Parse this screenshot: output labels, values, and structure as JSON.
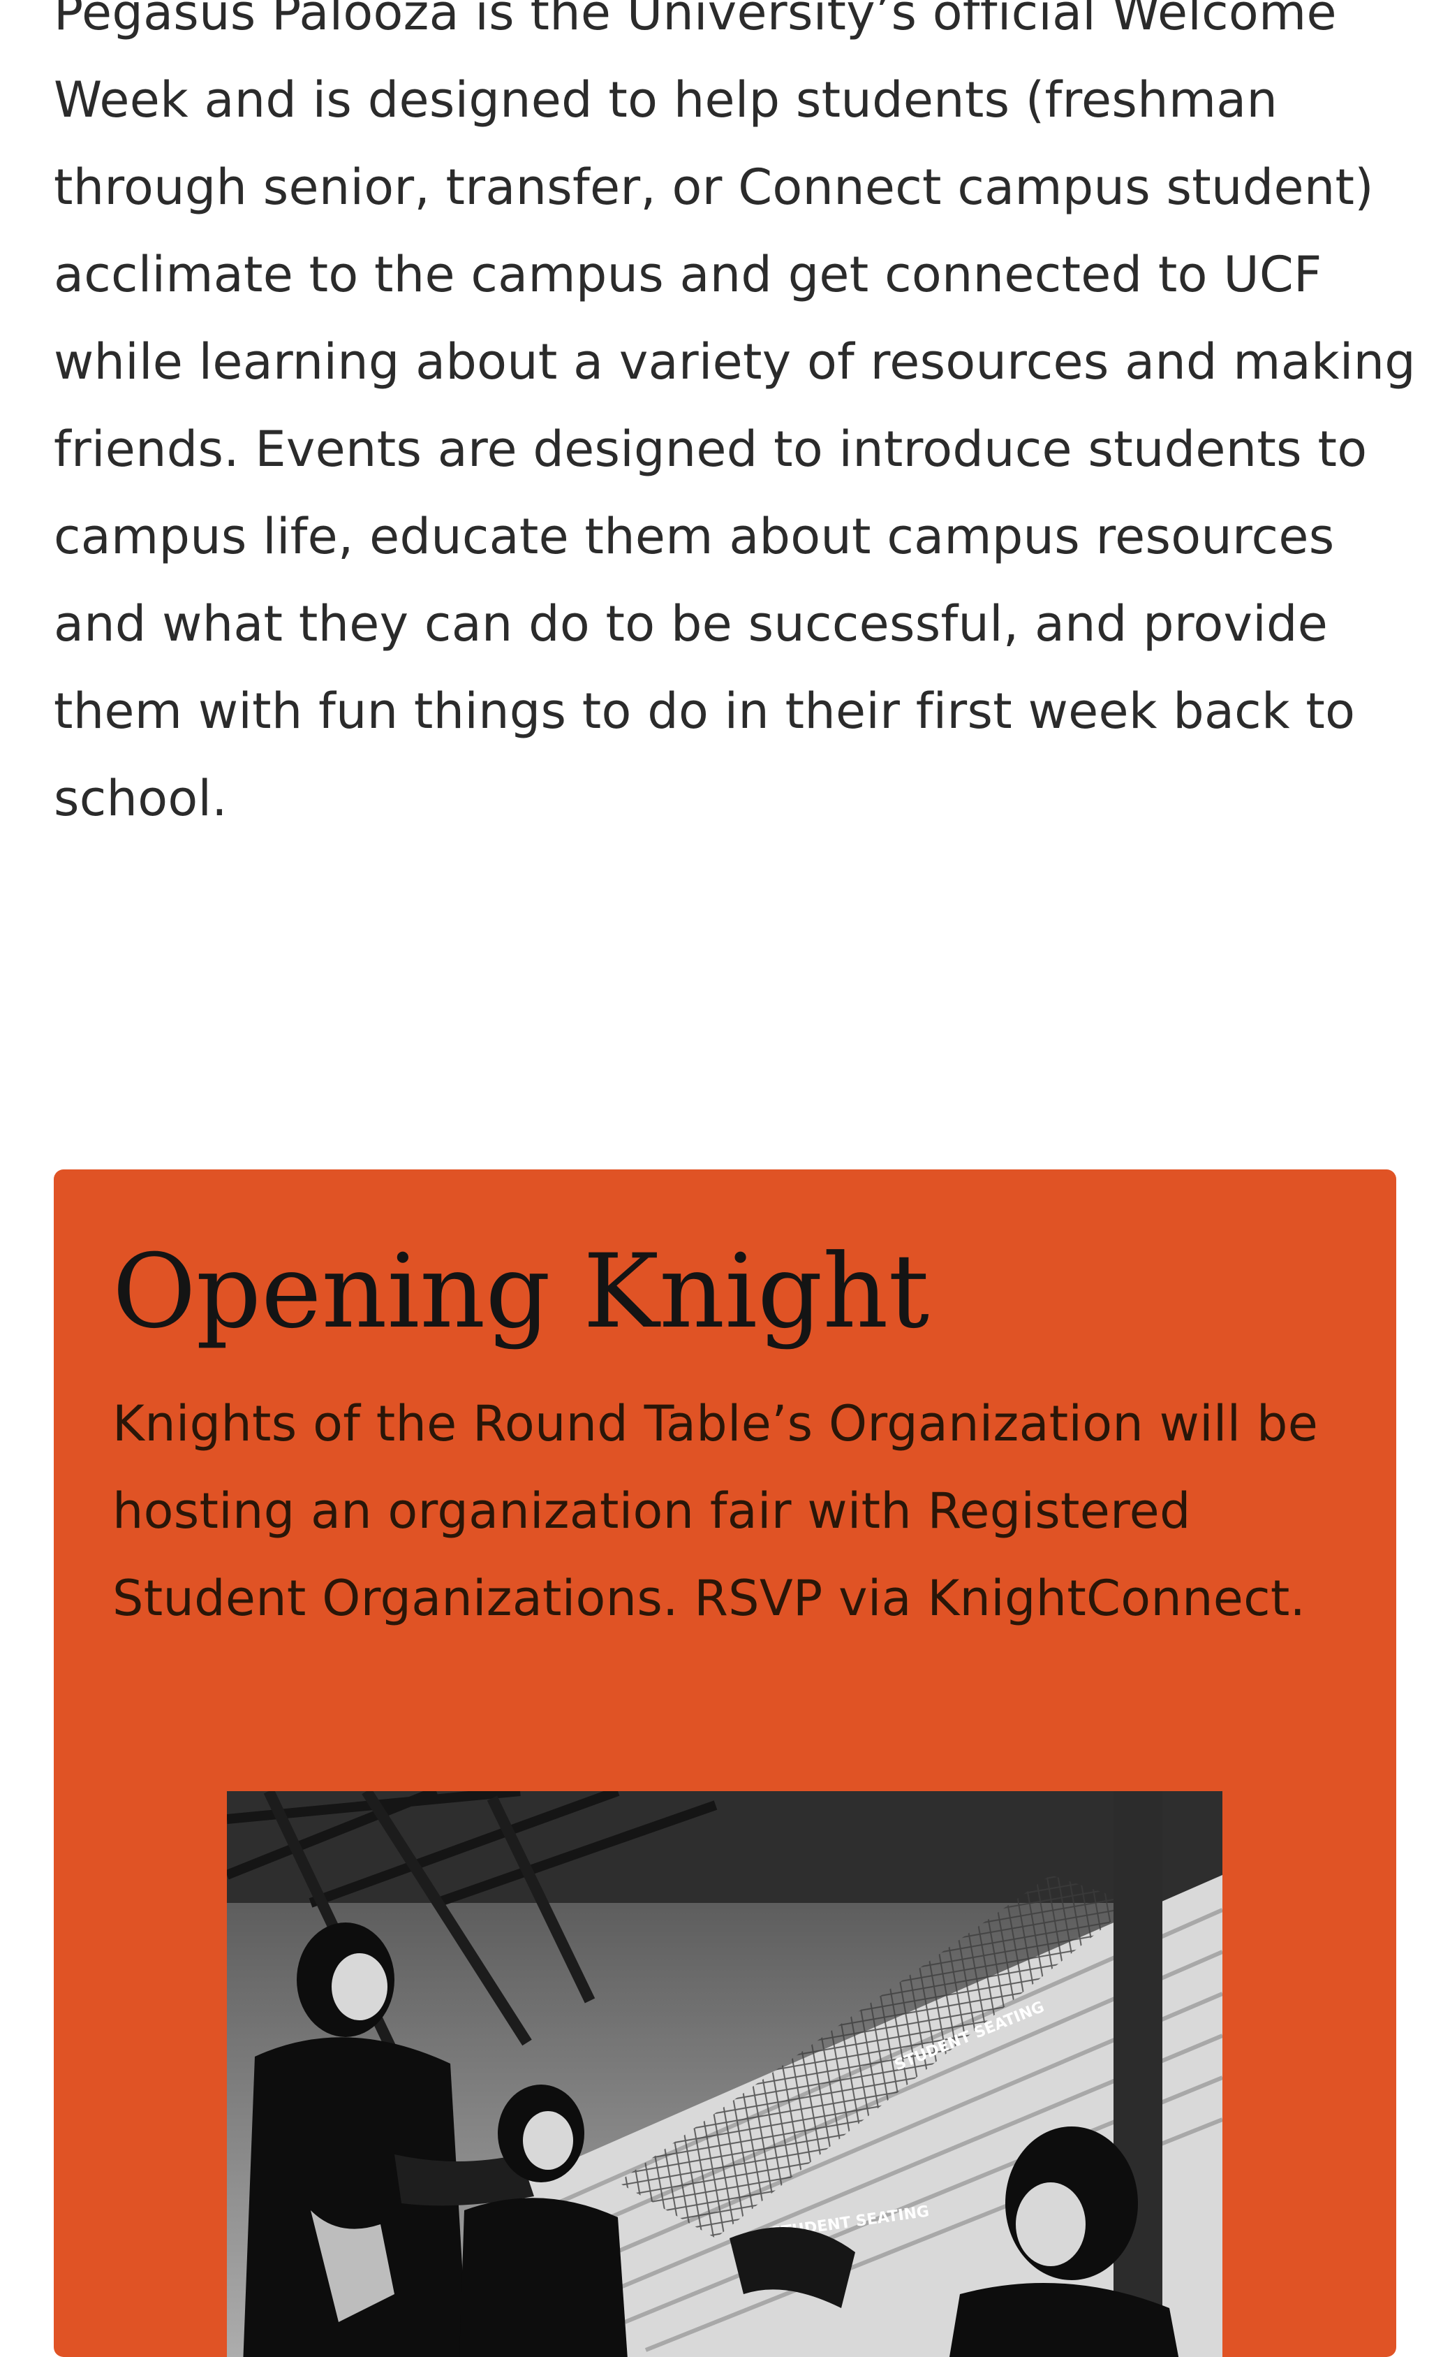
{
  "intro": {
    "paragraph": "Pegasus Palooza is the University’s official Welcome Week and is designed to help students (freshman through senior, transfer, or Connect campus student) acclimate to the campus and get connected to UCF while learning about a variety of resources and making friends. Events are designed to introduce students to campus life, educate them about campus resources and what they can do to be successful, and provide them with fun things to do in their first week back to school."
  },
  "card": {
    "background_color": "#e05325",
    "title": "Opening Knight",
    "description": "Knights of the Round Table’s Organization will be hosting an organization fair with Registered Student Organizations. RSVP via KnightConnect.",
    "photo": {
      "signs": [
        "STUDENT SEATING",
        "STUDENT SEATING"
      ]
    }
  }
}
